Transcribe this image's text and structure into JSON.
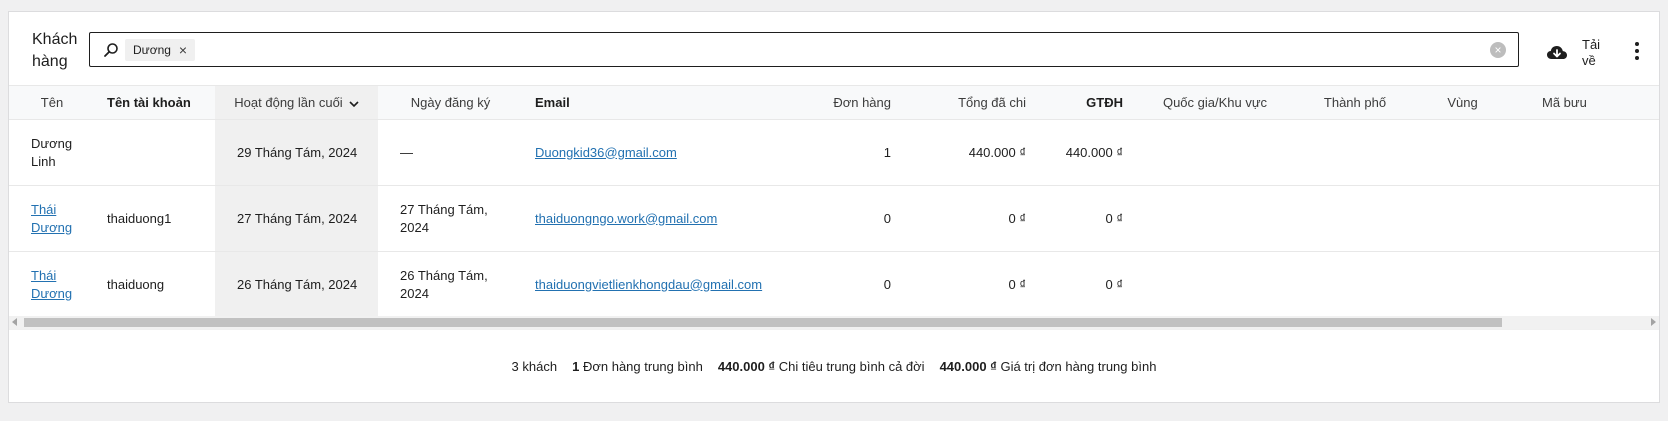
{
  "header": {
    "title": "Khách hàng",
    "search_chip": "Dương",
    "chip_remove": "×",
    "clear": "×",
    "download_label": "Tải về"
  },
  "table": {
    "columns": [
      "Tên",
      "Tên tài khoản",
      "Hoạt động lần cuối",
      "Ngày đăng ký",
      "Email",
      "Đơn hàng",
      "Tổng đã chi",
      "GTĐH",
      "Quốc gia/Khu vực",
      "Thành phố",
      "Vùng",
      "Mã bưu"
    ],
    "rows": [
      {
        "name": "Dương Linh",
        "username": "",
        "last_active": "29 Tháng Tám, 2024",
        "registered": "—",
        "email": "Duongkid36@gmail.com",
        "orders": "1",
        "total_spend": "440.000 ₫",
        "aov": "440.000 ₫",
        "country": "",
        "city": "",
        "region": "",
        "postcode": ""
      },
      {
        "name": "Thái Dương",
        "username": "thaiduong1",
        "last_active": "27 Tháng Tám, 2024",
        "registered": "27 Tháng Tám, 2024",
        "email": "thaiduongngo.work@gmail.com",
        "orders": "0",
        "total_spend": "0 ₫",
        "aov": "0 ₫",
        "country": "",
        "city": "",
        "region": "",
        "postcode": ""
      },
      {
        "name": "Thái Dương",
        "username": "thaiduong",
        "last_active": "26 Tháng Tám, 2024",
        "registered": "26 Tháng Tám, 2024",
        "email": "thaiduongvietlienkhongdau@gmail.com",
        "orders": "0",
        "total_spend": "0 ₫",
        "aov": "0 ₫",
        "country": "",
        "city": "",
        "region": "",
        "postcode": ""
      }
    ]
  },
  "summary": {
    "customers_count": "3",
    "customers_label": "khách",
    "avg_orders_value": "1",
    "avg_orders_label": "Đơn hàng trung bình",
    "avg_lifetime_value": "440.000 ₫",
    "avg_lifetime_label": "Chi tiêu trung bình cả đời",
    "avg_order_value_value": "440.000 ₫",
    "avg_order_value_label": "Giá trị đơn hàng trung bình"
  },
  "colors": {
    "link": "#2271b1",
    "sorted_column_bg": "#f0f0f0",
    "header_bg": "#f8f9fa"
  },
  "icons": {
    "search": "search-icon",
    "download": "cloud-download-icon",
    "more": "more-vertical-icon",
    "sort": "chevron-down-icon"
  }
}
